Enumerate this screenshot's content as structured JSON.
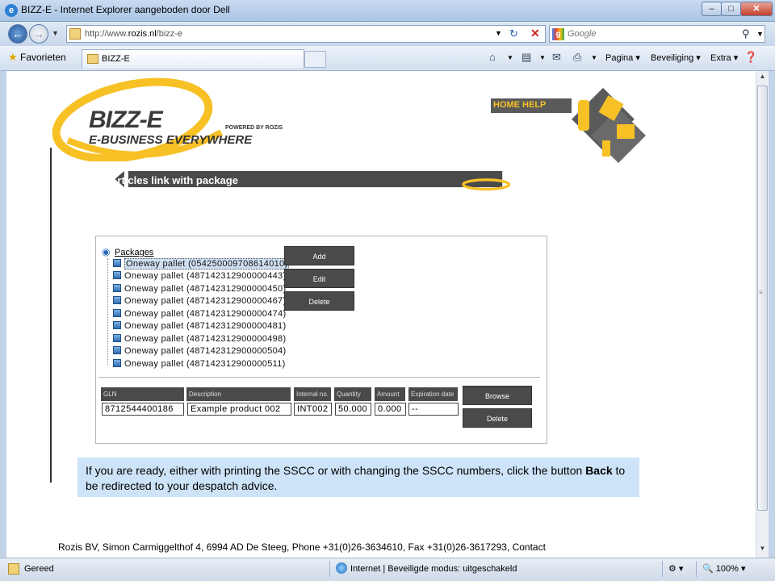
{
  "window": {
    "title": "BIZZ-E - Internet Explorer aangeboden door Dell",
    "min": "–",
    "max": "□",
    "close": "✕"
  },
  "navbar": {
    "url_prefix": "http://www.",
    "url_domain": "rozis.nl",
    "url_path": "/bizz-e",
    "search_placeholder": "Google"
  },
  "tabs": {
    "favorites_label": "Favorieten",
    "active_tab": "BIZZ-E",
    "commands": [
      "Pagina",
      "Beveiliging",
      "Extra"
    ]
  },
  "page": {
    "logo_text": "BIZZ-E",
    "logo_tagline": "E-BUSINESS EVERYWHERE",
    "logo_powered": "POWERED BY ROZIS",
    "home_help": "HOME HELP",
    "banner_title": "Articles link with package",
    "tree": {
      "root": "Packages",
      "items": [
        "Oneway pallet (054250009708614010)",
        "Oneway pallet (487142312900000443)",
        "Oneway pallet (487142312900000450)",
        "Oneway pallet (487142312900000467)",
        "Oneway pallet (487142312900000474)",
        "Oneway pallet (487142312900000481)",
        "Oneway pallet (487142312900000498)",
        "Oneway pallet (487142312900000504)",
        "Oneway pallet (487142312900000511)"
      ],
      "selected_index": 0
    },
    "buttons": {
      "add": "Add",
      "edit": "Edit",
      "delete": "Delete",
      "browse": "Browse",
      "delete2": "Delete"
    },
    "table": {
      "headers": [
        "GLN",
        "Description",
        "Internal no.",
        "Quantity",
        "Amount",
        "Expiration date"
      ],
      "row": [
        "8712544400186",
        "Example product 002",
        "INT002",
        "50.000",
        "0.000",
        "--"
      ]
    },
    "note_part1": "If you are ready, either with printing the SSCC or with changing the SSCC numbers, click the button ",
    "note_bold": "Back",
    "note_part2": " to be redirected to your despatch advice.",
    "footer": "Rozis BV, Simon Carmiggelthof 4, 6994 AD De Steeg, Phone +31(0)26-3634610, Fax +31(0)26-3617293, Contact"
  },
  "statusbar": {
    "status": "Gereed",
    "zone": "Internet | Beveiligde modus: uitgeschakeld",
    "zoom": "100%"
  },
  "colors": {
    "accent_yellow": "#f7c025",
    "dark_gray": "#4a4a4a",
    "note_bg": "#cde3f7"
  }
}
